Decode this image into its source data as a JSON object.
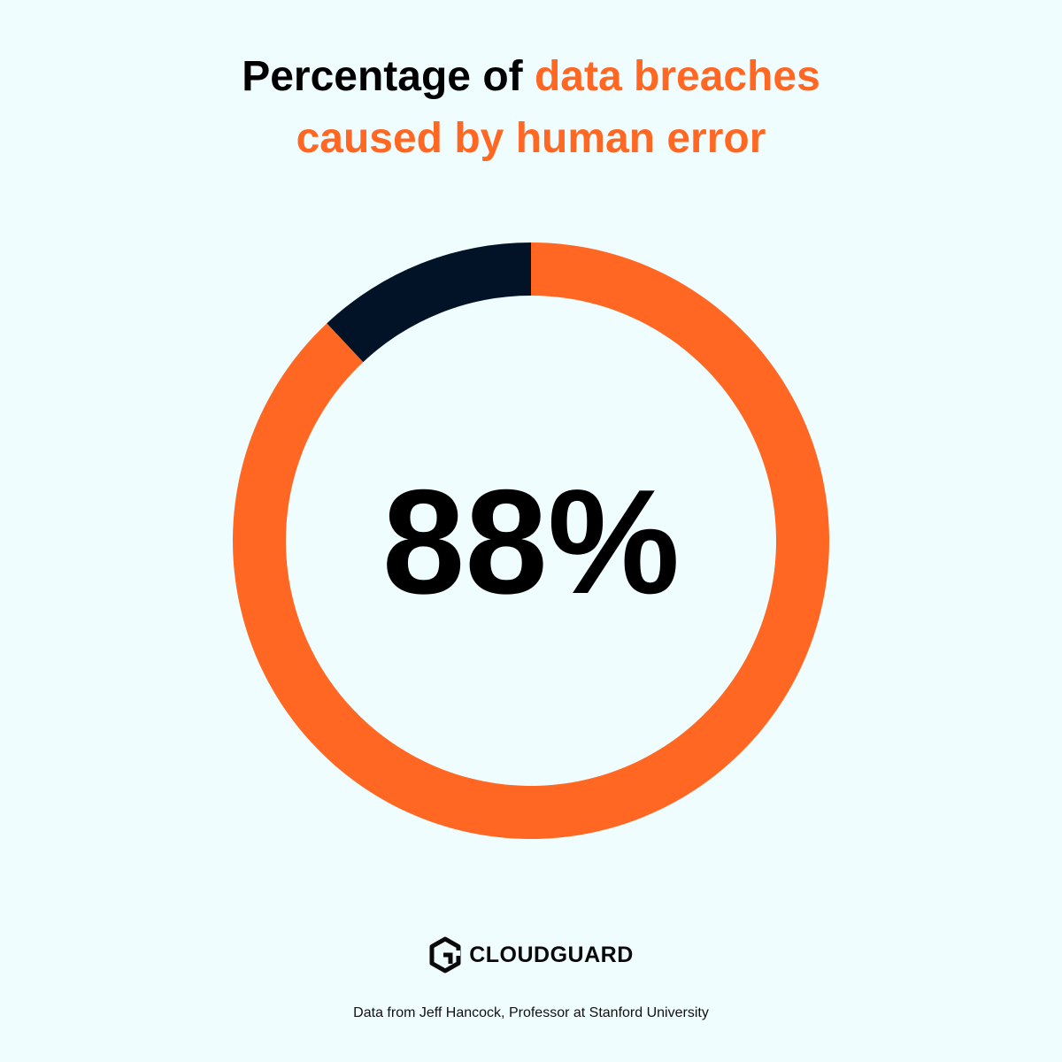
{
  "title": {
    "part1": "Percentage of ",
    "part2": "data breaches",
    "part3": "caused by human error"
  },
  "chart_data": {
    "type": "pie",
    "slices": [
      {
        "value": 88,
        "color": "#ff6723"
      },
      {
        "value": 12,
        "color": "#021327"
      }
    ],
    "center_label": "88%"
  },
  "logo": {
    "text": "CLOUDGUARD",
    "icon": "cloudguard-logo-icon"
  },
  "source": "Data from Jeff Hancock, Professor at Stanford University",
  "colors": {
    "background": "#effdfe",
    "accent": "#ff6723",
    "dark": "#021327"
  }
}
